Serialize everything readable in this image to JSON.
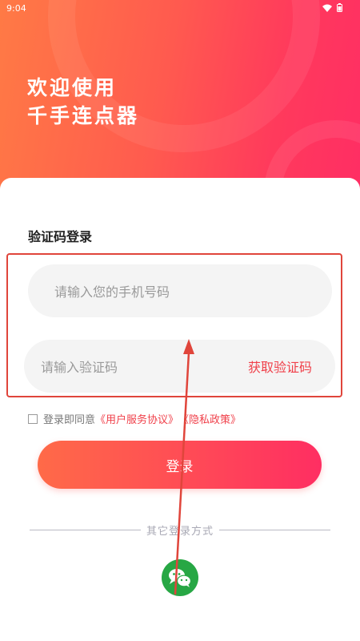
{
  "status_bar": {
    "time": "9:04",
    "icons": [
      "wifi-icon",
      "battery-icon"
    ]
  },
  "header": {
    "welcome_line1": "欢迎使用",
    "welcome_line2": "千手连点器"
  },
  "login": {
    "title": "验证码登录",
    "phone_placeholder": "请输入您的手机号码",
    "code_placeholder": "请输入验证码",
    "get_code_label": "获取验证码",
    "agreement_prefix": "登录即同意",
    "user_agreement": "《用户服务协议》",
    "privacy_policy": "《隐私政策》",
    "submit_label": "登录"
  },
  "other_login": {
    "divider_text": "其它登录方式",
    "icons": [
      "wechat-icon"
    ]
  },
  "colors": {
    "accent": "#f0404a",
    "wechat": "#27a744",
    "annotation": "#e0453b"
  }
}
